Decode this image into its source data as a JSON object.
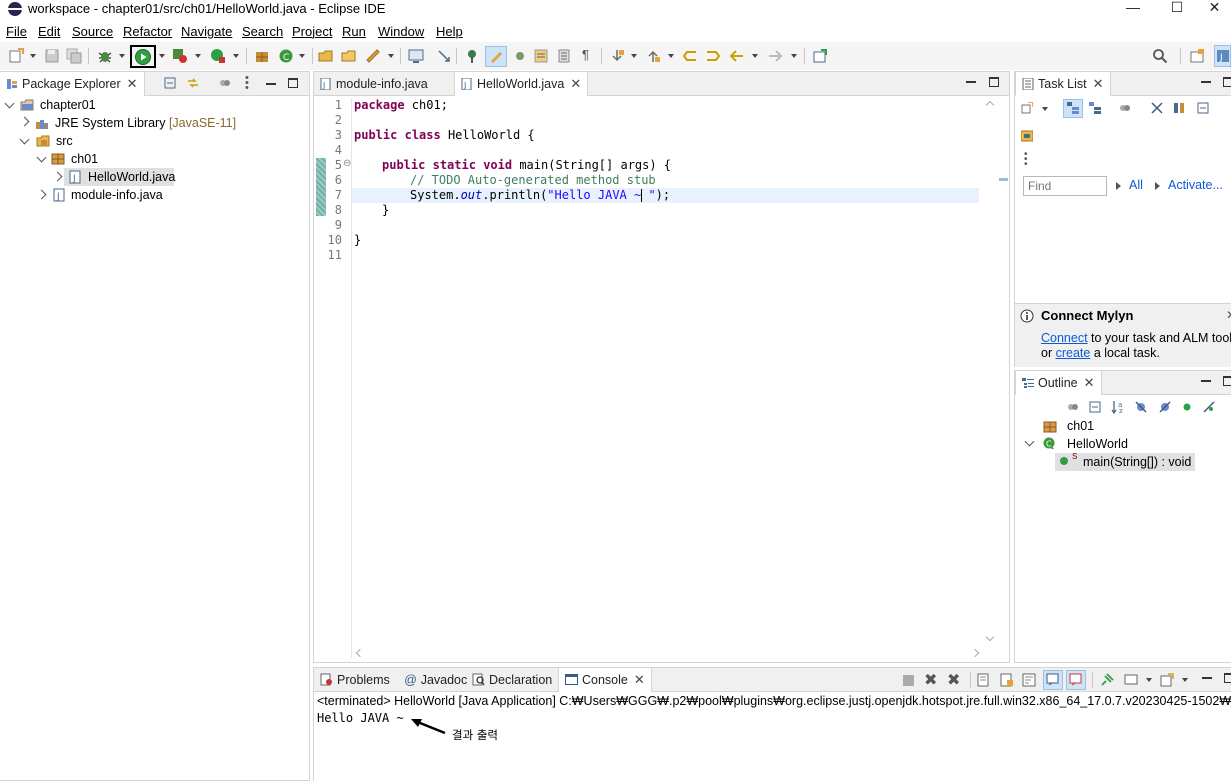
{
  "window": {
    "title": "workspace - chapter01/src/ch01/HelloWorld.java - Eclipse IDE",
    "minimize": "—",
    "maximize": "☐",
    "close": "✕"
  },
  "menu": [
    "File",
    "Edit",
    "Source",
    "Refactor",
    "Navigate",
    "Search",
    "Project",
    "Run",
    "Window",
    "Help"
  ],
  "package_explorer": {
    "tab_label": "Package Explorer",
    "tree": {
      "project": "chapter01",
      "jre_label": "JRE System Library",
      "jre_version": "[JavaSE-11]",
      "src": "src",
      "package": "ch01",
      "file_selected": "HelloWorld.java",
      "module_info": "module-info.java"
    }
  },
  "editor": {
    "tabs": [
      "module-info.java",
      "HelloWorld.java"
    ],
    "active_tab": "HelloWorld.java",
    "line_numbers": [
      "1",
      "2",
      "3",
      "4",
      "5",
      "6",
      "7",
      "8",
      "9",
      "10",
      "11"
    ],
    "code": {
      "l1_kw": "package",
      "l1_rest": " ch01;",
      "l3_kw1": "public",
      "l3_kw2": "class",
      "l3_rest": " HelloWorld {",
      "l5_kw1": "public",
      "l5_kw2": "static",
      "l5_kw3": "void",
      "l5_rest": " main(String[] args) {",
      "l6_comment": "// TODO Auto-generated method stub",
      "l7_pre": "System.",
      "l7_field": "out",
      "l7_mid": ".println(",
      "l7_str": "\"Hello JAVA ~ \"",
      "l7_end": ");",
      "l8": "}",
      "l10": "}"
    }
  },
  "task_list": {
    "tab_label": "Task List",
    "find_placeholder": "Find",
    "all_label": "All",
    "activate_label": "Activate...",
    "connect_title": "Connect Mylyn",
    "connect_link": "Connect",
    "connect_text": " to your task and ALM tools",
    "or_text": "or ",
    "create_link": "create",
    "local_task_text": " a local task."
  },
  "outline": {
    "tab_label": "Outline",
    "items": [
      "ch01",
      "HelloWorld",
      "main(String[]) : void"
    ],
    "static_marker": "S"
  },
  "console": {
    "tabs": [
      "Problems",
      "Javadoc",
      "Declaration",
      "Console"
    ],
    "active_tab": "Console",
    "javadoc_glyph": "@",
    "status_line": "<terminated> HelloWorld [Java Application] C:₩Users₩GGG₩.p2₩pool₩plugins₩org.eclipse.justj.openjdk.hotspot.jre.full.win32.x86_64_17.0.7.v20230425-1502₩jre₩bin₩",
    "output": "Hello JAVA ~",
    "annotation": "결과 출력"
  },
  "colors": {
    "keyword": "#7f0055",
    "comment": "#3f7f5f",
    "string": "#2a00ff",
    "field": "#0000c0",
    "link": "#0b5ad8",
    "current_line": "#e8f2fe",
    "run_button": "#2ea043"
  }
}
